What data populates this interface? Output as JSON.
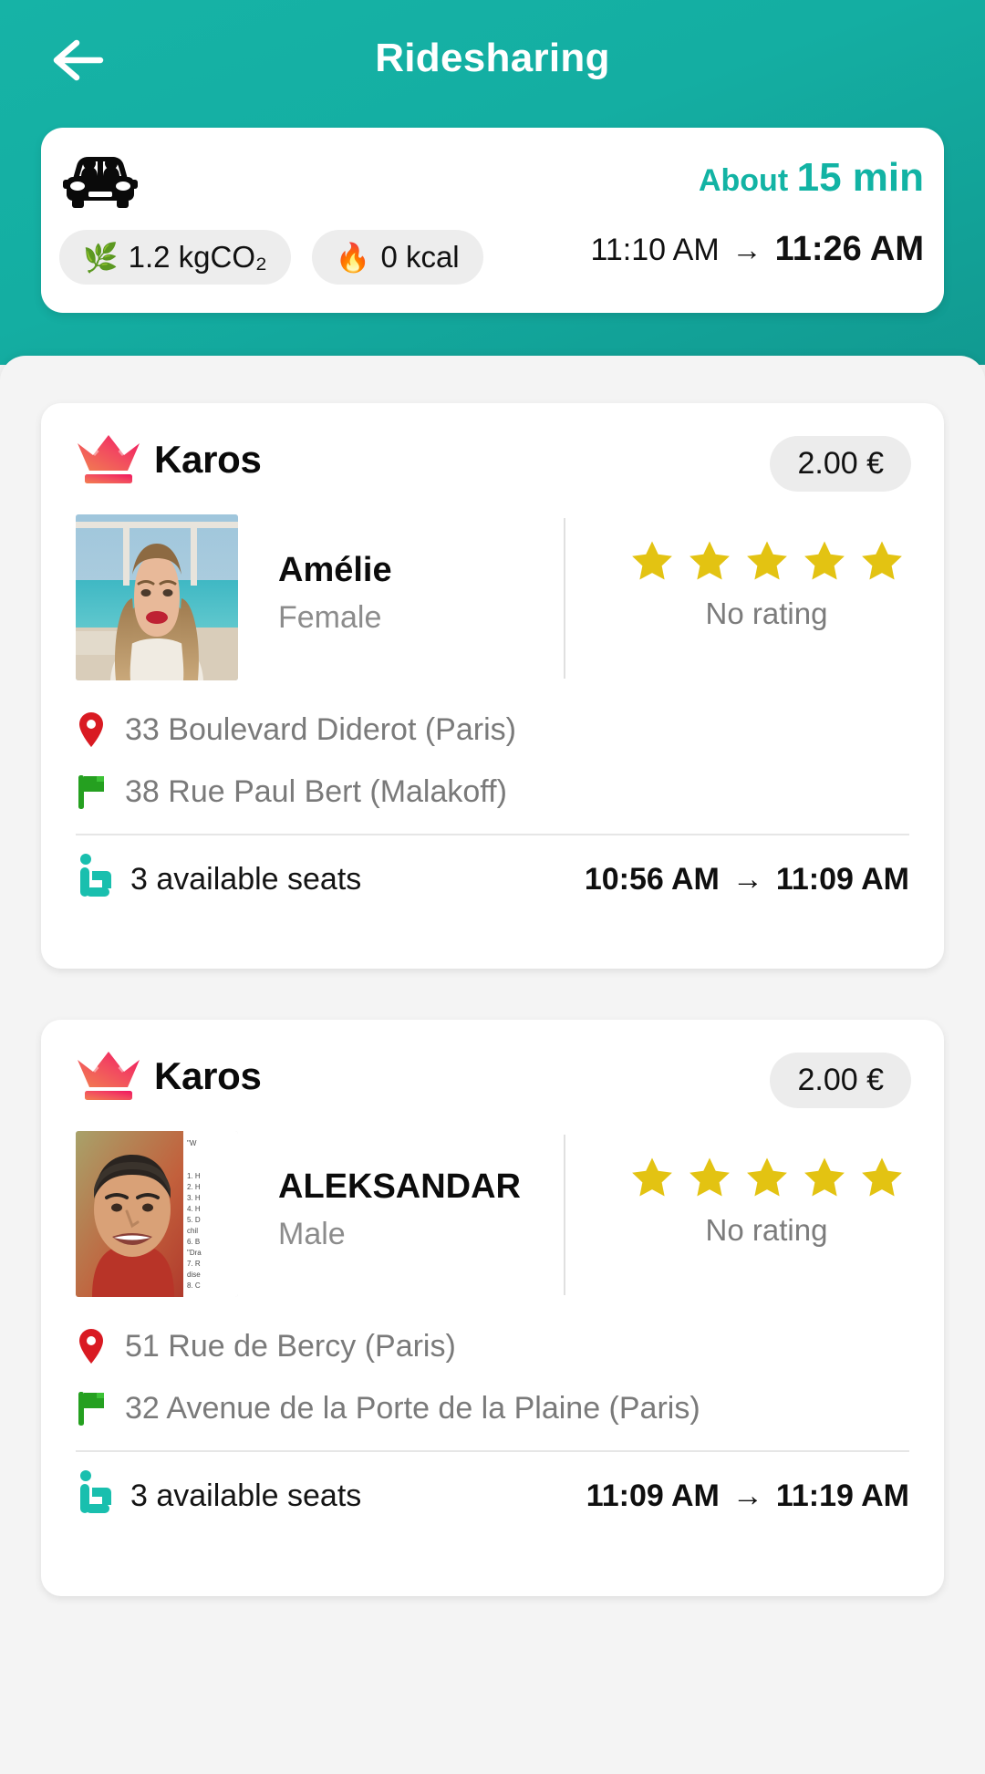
{
  "appbar": {
    "title": "Ridesharing",
    "back_icon": "arrow-left-icon"
  },
  "theme": {
    "accent_teal": "#12B3A4",
    "header_gradient_start": "#16B3A6",
    "header_gradient_end": "#119A91",
    "sheet_bg": "#f4f4f4",
    "star_yellow": "#E3C312",
    "pin_red": "#D91A22",
    "flag_green": "#25A020",
    "brand_gradient_start": "#F2714E",
    "brand_gradient_end": "#F0175F"
  },
  "summary": {
    "mode_icon": "carpool-car-icon",
    "eta_prefix": "About",
    "eta_value": "15 min",
    "badges": [
      {
        "icon": "leaf-icon",
        "glyph": "🌿",
        "label": "1.2 kgCO₂"
      },
      {
        "icon": "flame-icon",
        "glyph": "🔥",
        "label": "0 kcal"
      }
    ],
    "depart_time": "11:10 AM",
    "arrow": "→",
    "arrive_time": "11:26 AM"
  },
  "rides": [
    {
      "brand": "Karos",
      "brand_logo_icon": "crown-icon",
      "price": "2.00 €",
      "driver": {
        "name": "Amélie",
        "gender": "Female",
        "avatar_icon": "driver-photo-female"
      },
      "rating": {
        "stars": 5,
        "label": "No rating"
      },
      "origin": "33 Boulevard Diderot (Paris)",
      "destination": "38 Rue Paul Bert (Malakoff)",
      "seats": "3 available seats",
      "seats_icon": "seat-icon",
      "pickup_time": "10:56 AM",
      "arrow": "→",
      "dropoff_time": "11:09 AM"
    },
    {
      "brand": "Karos",
      "brand_logo_icon": "crown-icon",
      "price": "2.00 €",
      "driver": {
        "name": "ALEKSANDAR",
        "gender": "Male",
        "avatar_icon": "driver-photo-male"
      },
      "rating": {
        "stars": 5,
        "label": "No rating"
      },
      "origin": "51 Rue de Bercy (Paris)",
      "destination": "32 Avenue de la Porte de la Plaine (Paris)",
      "seats": "3 available seats",
      "seats_icon": "seat-icon",
      "pickup_time": "11:09 AM",
      "arrow": "→",
      "dropoff_time": "11:19 AM"
    }
  ]
}
